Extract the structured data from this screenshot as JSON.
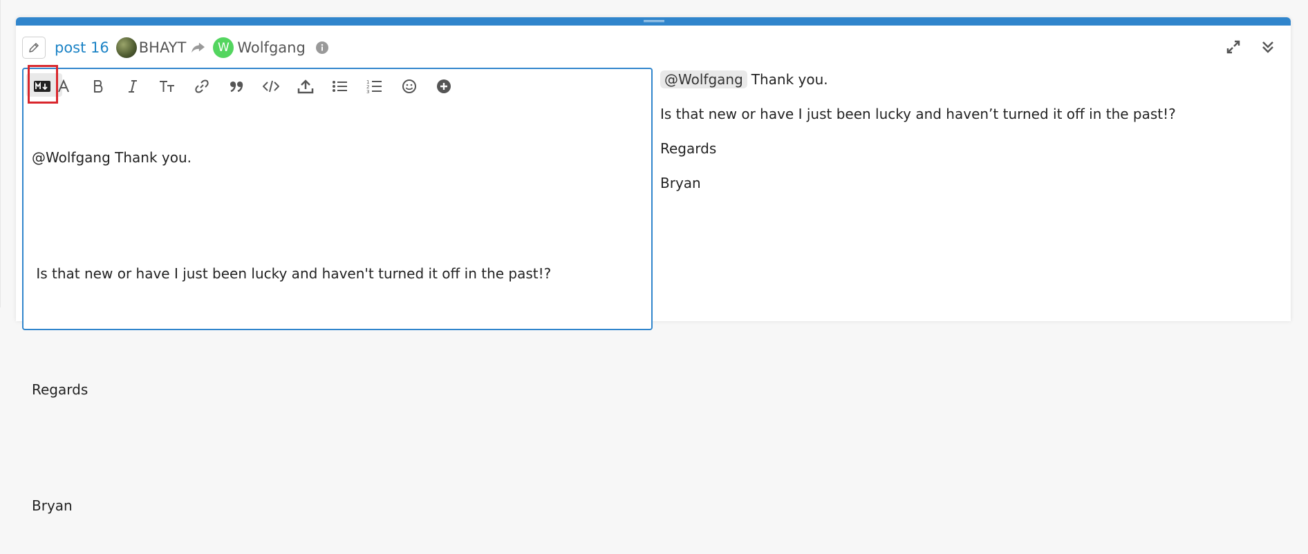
{
  "header": {
    "post_link": "post 16",
    "original_user": "BHAYT",
    "reply_to_user": "Wolfgang",
    "reply_to_initial": "W"
  },
  "toolbar": {
    "items": [
      "markdown-toggle",
      "font-style",
      "bold",
      "italic",
      "heading",
      "link",
      "quote",
      "code",
      "upload",
      "bullet-list",
      "numbered-list",
      "emoji",
      "options"
    ]
  },
  "editor": {
    "lines": [
      "@Wolfgang Thank you.",
      "",
      " Is that new or have I just been lucky and haven't turned it off in the past!?",
      "",
      "Regards",
      "",
      "Bryan"
    ]
  },
  "preview": {
    "mention": "@Wolfgang",
    "first_text": "Thank you.",
    "paragraph2": "Is that new or have I just been lucky and haven’t turned it off in the past!?",
    "paragraph3": "Regards",
    "paragraph4": "Bryan"
  },
  "colors": {
    "accent": "#3085cc",
    "link": "#1a82c5",
    "highlight": "#d9262c",
    "wolfgang_avatar": "#53d55f"
  }
}
